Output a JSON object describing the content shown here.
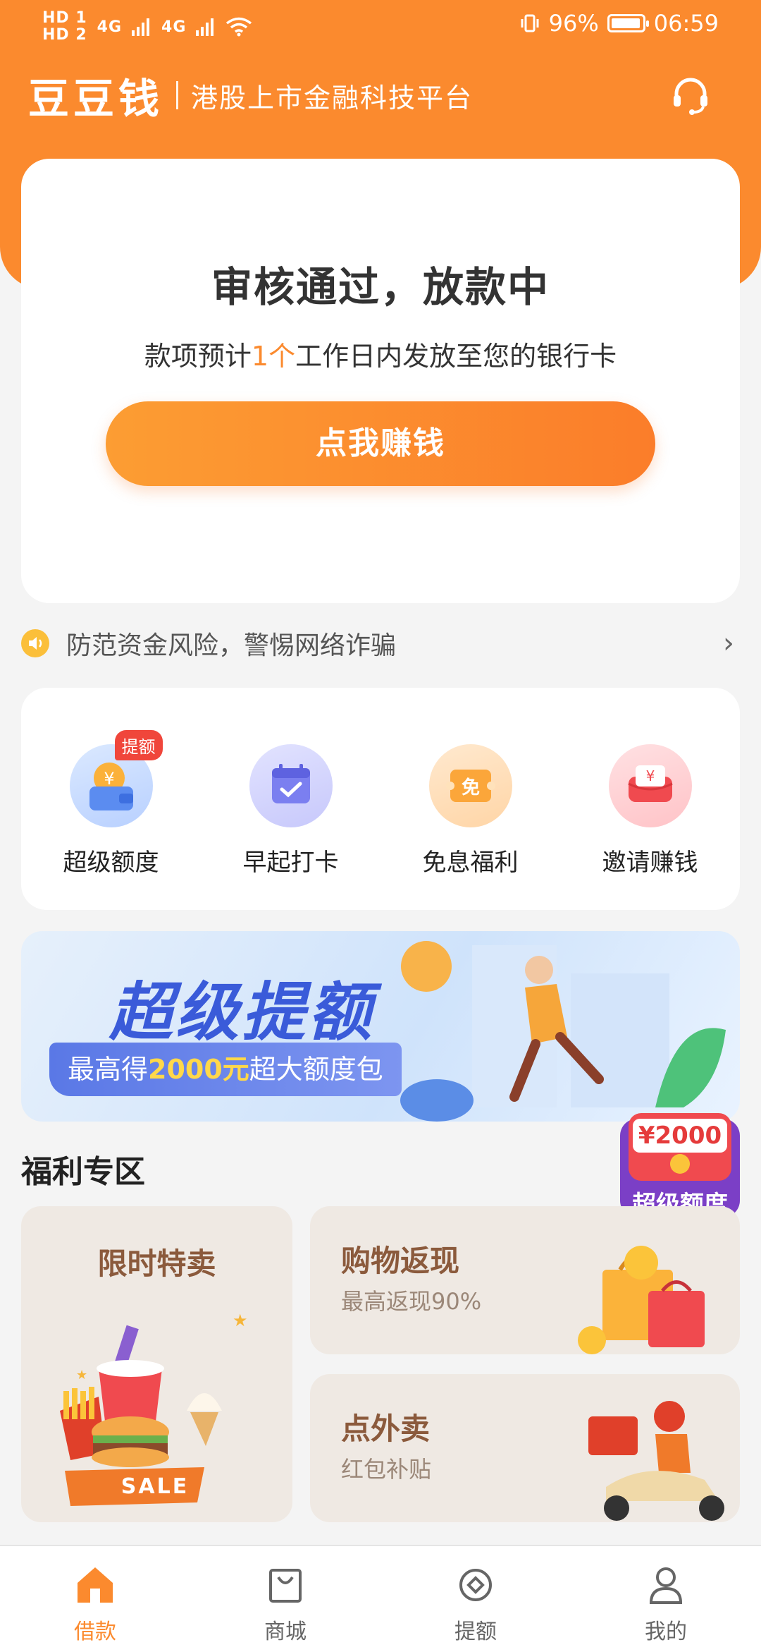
{
  "status_bar": {
    "sim1": "HD 1",
    "sim2": "HD 2",
    "net1": "4G",
    "net2": "4G",
    "battery": "96%",
    "battery_level": 0.96,
    "time": "06:59"
  },
  "header": {
    "logo": "豆豆钱",
    "slogan": "港股上市金融科技平台",
    "service_icon": "headset-icon"
  },
  "status_card": {
    "title": "审核通过，放款中",
    "desc_pre": "款项预计",
    "desc_highlight": "1个",
    "desc_post": "工作日内发放至您的银行卡",
    "button": "点我赚钱"
  },
  "notice": {
    "text": "防范资金风险，警惕网络诈骗",
    "icon": "speaker-icon"
  },
  "quick_actions": [
    {
      "label": "超级额度",
      "icon": "wallet-coin-icon",
      "badge": "提额"
    },
    {
      "label": "早起打卡",
      "icon": "calendar-check-icon",
      "badge": ""
    },
    {
      "label": "免息福利",
      "icon": "coupon-free-icon",
      "badge": ""
    },
    {
      "label": "邀请赚钱",
      "icon": "red-envelope-icon",
      "badge": ""
    }
  ],
  "banner": {
    "title": "超级提额",
    "strip_pre": "最高得",
    "strip_num": "2000元",
    "strip_post": "超大额度包"
  },
  "float_badge": {
    "amount": "¥2000",
    "label": "超级额度"
  },
  "welfare": {
    "title": "福利专区",
    "tiles": [
      {
        "title": "限时特卖",
        "sub": "",
        "sale_text": "SALE"
      },
      {
        "title": "购物返现",
        "sub": "最高返现90%"
      },
      {
        "title": "点外卖",
        "sub": "红包补贴"
      }
    ]
  },
  "tabbar": {
    "items": [
      {
        "label": "借款",
        "icon": "home-icon",
        "active": true
      },
      {
        "label": "商城",
        "icon": "shopping-bag-icon",
        "active": false
      },
      {
        "label": "提额",
        "icon": "target-icon",
        "active": false
      },
      {
        "label": "我的",
        "icon": "user-icon",
        "active": false
      }
    ]
  },
  "colors": {
    "brand": "#fb8a2e",
    "background": "#f4f4f4",
    "card": "#ffffff"
  }
}
